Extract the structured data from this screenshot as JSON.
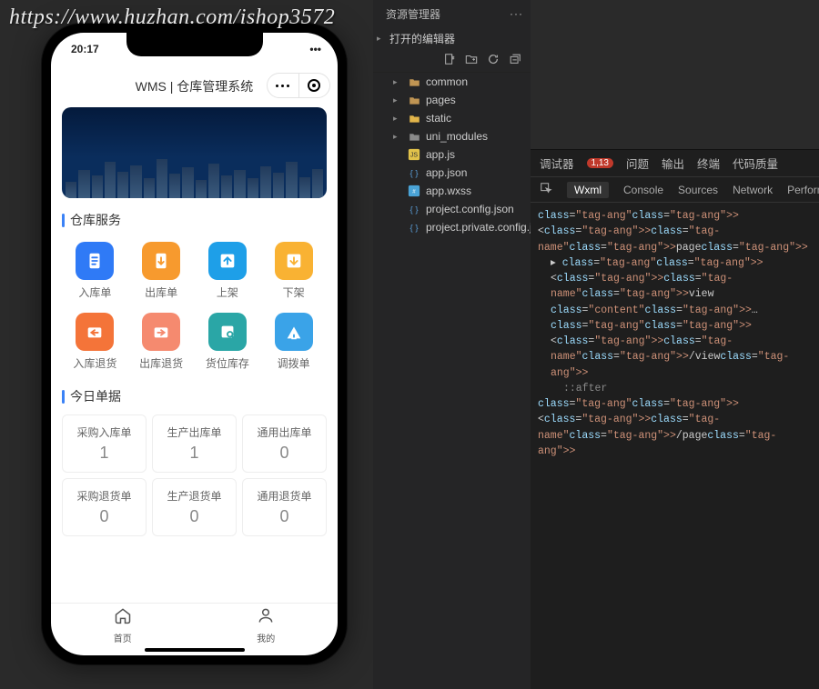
{
  "watermark": "https://www.huzhan.com/ishop3572",
  "phone": {
    "status_time": "20:17",
    "app_title": "WMS | 仓库管理系统",
    "banner_label": "city-night-banner",
    "section_services": "仓库服务",
    "services": [
      {
        "label": "入库单",
        "color": "c-blue",
        "icon": "file-import"
      },
      {
        "label": "出库单",
        "color": "c-orange",
        "icon": "file-export"
      },
      {
        "label": "上架",
        "color": "c-cyan",
        "icon": "arrow-up-box"
      },
      {
        "label": "下架",
        "color": "c-amber",
        "icon": "arrow-down-box"
      },
      {
        "label": "入库退货",
        "color": "c-deeporange",
        "icon": "return-in"
      },
      {
        "label": "出库退货",
        "color": "c-coral",
        "icon": "return-out"
      },
      {
        "label": "货位库存",
        "color": "c-teal",
        "icon": "inventory"
      },
      {
        "label": "调拨单",
        "color": "c-sky",
        "icon": "transfer"
      }
    ],
    "section_today": "今日单据",
    "today_cards": [
      {
        "title": "采购入库单",
        "value": "1"
      },
      {
        "title": "生产出库单",
        "value": "1"
      },
      {
        "title": "通用出库单",
        "value": "0"
      },
      {
        "title": "采购退货单",
        "value": "0"
      },
      {
        "title": "生产退货单",
        "value": "0"
      },
      {
        "title": "通用退货单",
        "value": "0"
      }
    ],
    "tabs": [
      {
        "label": "首页",
        "icon": "home"
      },
      {
        "label": "我的",
        "icon": "person"
      }
    ]
  },
  "explorer": {
    "title": "资源管理器",
    "open_editors": "打开的编辑器",
    "toolbar": [
      "new-file",
      "new-folder",
      "refresh",
      "collapse"
    ],
    "tree": [
      {
        "kind": "folder",
        "label": "common",
        "color": "#c09553"
      },
      {
        "kind": "folder",
        "label": "pages",
        "color": "#c09553"
      },
      {
        "kind": "folder",
        "label": "static",
        "color": "#e2b54a"
      },
      {
        "kind": "folder",
        "label": "uni_modules",
        "color": "#8a8a8a"
      },
      {
        "kind": "file",
        "label": "app.js",
        "icon": "js",
        "color": "#e2c24a"
      },
      {
        "kind": "file",
        "label": "app.json",
        "icon": "json",
        "color": "#5a9dd6"
      },
      {
        "kind": "file",
        "label": "app.wxss",
        "icon": "wxss",
        "color": "#4aa3d6"
      },
      {
        "kind": "file",
        "label": "project.config.json",
        "icon": "json",
        "color": "#5a9dd6"
      },
      {
        "kind": "file",
        "label": "project.private.config.js…",
        "icon": "json",
        "color": "#5a9dd6"
      }
    ]
  },
  "devtools": {
    "primary_tabs": [
      {
        "label": "调试器",
        "badge": "1,13"
      },
      {
        "label": "问题"
      },
      {
        "label": "输出"
      },
      {
        "label": "终端"
      },
      {
        "label": "代码质量"
      }
    ],
    "panel_tabs": [
      "Wxml",
      "Console",
      "Sources",
      "Network",
      "Performance"
    ],
    "active_panel": "Wxml",
    "dom_lines": [
      {
        "html": "<page>"
      },
      {
        "html": "▸ <view class=\"content\">…</view>",
        "indent": 1
      },
      {
        "html": "::after",
        "indent": 2,
        "pseudo": true
      },
      {
        "html": "</page>"
      }
    ]
  }
}
